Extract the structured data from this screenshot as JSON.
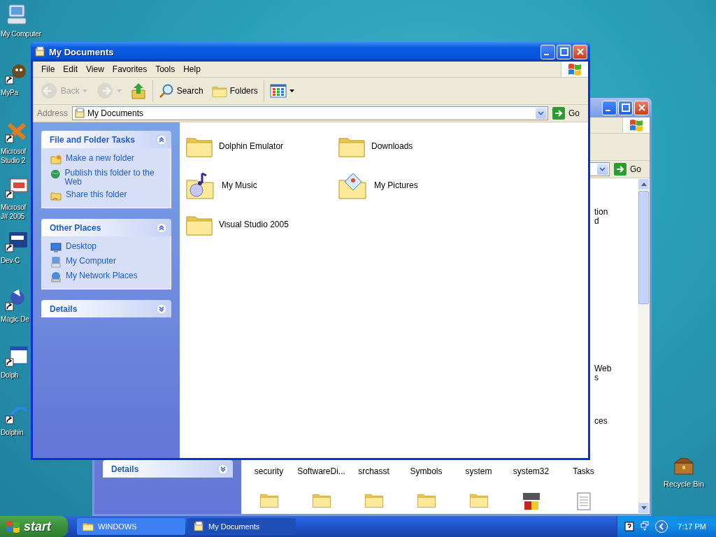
{
  "desktop_icons": [
    {
      "kind": "computer",
      "lines": [
        "My Computer"
      ]
    },
    {
      "kind": "app",
      "lines": [
        "MyPa"
      ]
    },
    {
      "kind": "studio",
      "lines": [
        "Microsof",
        "Studio 2"
      ]
    },
    {
      "kind": "jsharp",
      "lines": [
        "Microsof",
        "J# 2005"
      ]
    },
    {
      "kind": "devcpp",
      "lines": [
        "Dev-C"
      ]
    },
    {
      "kind": "wizard",
      "lines": [
        "Magic De"
      ]
    },
    {
      "kind": "window",
      "lines": [
        "Dolph"
      ]
    },
    {
      "kind": "dolphin",
      "lines": [
        "Dolphin"
      ]
    },
    {
      "kind": "recycle",
      "lines": [
        "Recycle Bin"
      ]
    }
  ],
  "back_window": {
    "details_panel": {
      "title": "Details",
      "expanded": false
    },
    "address": {
      "go": "Go"
    },
    "partial_items": [
      {
        "lines": [
          "tion",
          "d"
        ]
      },
      {
        "lines": [
          "Web",
          "s"
        ]
      },
      {
        "lines": [
          "ces"
        ]
      }
    ],
    "bottom_labels": [
      "security",
      "SoftwareDi...",
      "srchasst",
      "Symbols",
      "system",
      "system32",
      "Tasks"
    ],
    "next_row": [
      {
        "kind": "folder"
      },
      {
        "kind": "folder"
      },
      {
        "kind": "folder"
      },
      {
        "kind": "folder"
      },
      {
        "kind": "folder"
      },
      {
        "kind": "app"
      },
      {
        "kind": "document"
      }
    ]
  },
  "window": {
    "title": "My Documents",
    "menu": [
      "File",
      "Edit",
      "View",
      "Favorites",
      "Tools",
      "Help"
    ],
    "toolbar": [
      {
        "kind": "back",
        "label": "Back",
        "disabled": true
      },
      {
        "kind": "forward",
        "disabled": true
      },
      {
        "kind": "up",
        "disabled": false
      },
      {
        "kind": "search",
        "label": "Search",
        "disabled": false
      },
      {
        "kind": "folders",
        "label": "Folders",
        "disabled": false
      },
      {
        "kind": "views",
        "disabled": false
      }
    ],
    "address": {
      "label": "Address",
      "value": "My Documents",
      "go": "Go"
    },
    "panels": [
      {
        "title": "File and Folder Tasks",
        "expanded": true,
        "items": [
          {
            "kind": "newfolder",
            "label": "Make a new folder"
          },
          {
            "kind": "publish",
            "label": "Publish this folder to the Web"
          },
          {
            "kind": "share",
            "label": "Share this folder"
          }
        ]
      },
      {
        "title": "Other Places",
        "expanded": true,
        "items": [
          {
            "kind": "desktop",
            "label": "Desktop"
          },
          {
            "kind": "computer",
            "label": "My Computer"
          },
          {
            "kind": "network",
            "label": "My Network Places"
          }
        ]
      },
      {
        "title": "Details",
        "expanded": false
      }
    ],
    "files": [
      {
        "kind": "folder",
        "label": "Dolphin Emulator"
      },
      {
        "kind": "folder",
        "label": "Downloads"
      },
      {
        "kind": "music",
        "label": "My Music"
      },
      {
        "kind": "pictures",
        "label": "My Pictures"
      },
      {
        "kind": "folder",
        "label": "Visual Studio 2005"
      }
    ]
  },
  "taskbar": {
    "start": "start",
    "tasks": [
      {
        "kind": "folder",
        "label": "WINDOWS",
        "selected": false
      },
      {
        "kind": "docs",
        "label": "My Documents",
        "selected": true
      }
    ],
    "clock": "7:17 PM"
  }
}
